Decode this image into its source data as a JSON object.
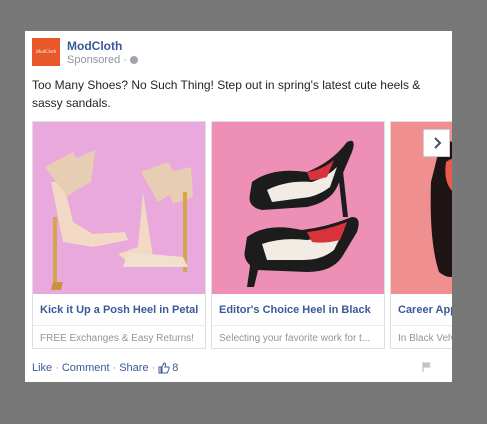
{
  "post": {
    "page_name": "ModCloth",
    "logo_text": "ModCloth",
    "sponsored": "Sponsored",
    "text": "Too Many Shoes? No Such Thing! Step out in spring's latest cute heels & sassy sandals."
  },
  "carousel": {
    "items": [
      {
        "title": "Kick it Up a Posh Heel in Petal",
        "subtitle": "FREE Exchanges & Easy Returns!",
        "image_bg": "#e9a9dd"
      },
      {
        "title": "Editor's Choice Heel in Black",
        "subtitle": "Selecting your favorite work for t...",
        "image_bg": "#ee8fb6"
      },
      {
        "title": "Career Appeal Heel in Black",
        "subtitle": "In Black Velvet",
        "image_bg": "#ef8f8f"
      }
    ],
    "next_icon": "chevron-right-icon"
  },
  "footer": {
    "like": "Like",
    "comment": "Comment",
    "share": "Share",
    "like_count": "8",
    "separator": "·"
  },
  "colors": {
    "brand_blue": "#3b5998",
    "logo_orange": "#e8582a",
    "muted_gray": "#90949c"
  }
}
